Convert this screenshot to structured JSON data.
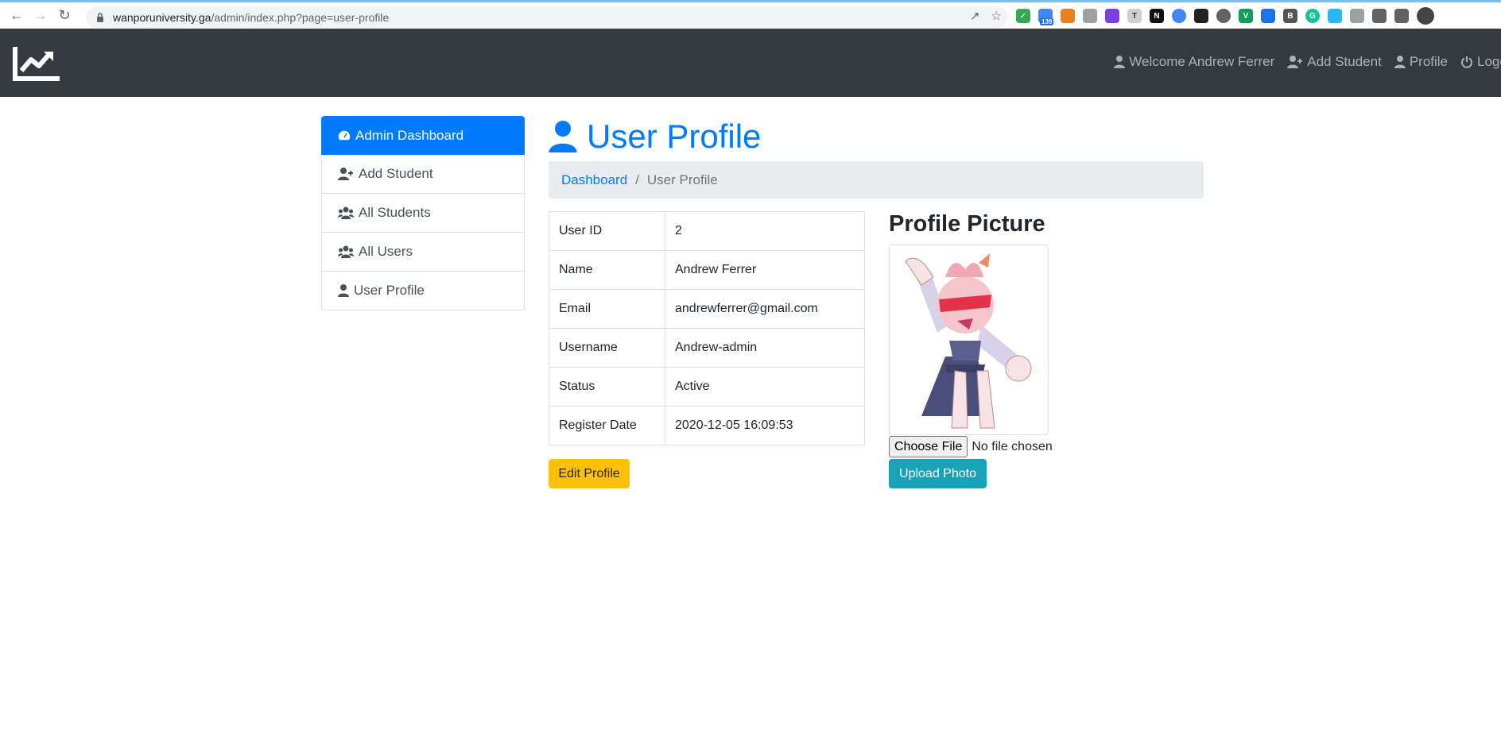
{
  "browser": {
    "url_host": "wanporuniversity.ga",
    "url_path": "/admin/index.php?page=user-profile",
    "ext_badge": "139"
  },
  "navbar": {
    "links": [
      {
        "label": "Welcome Andrew Ferrer",
        "icon": "user-icon"
      },
      {
        "label": "Add Student",
        "icon": "user-plus-icon"
      },
      {
        "label": "Profile",
        "icon": "user-icon"
      },
      {
        "label": "Logout",
        "icon": "power-icon"
      }
    ]
  },
  "sidebar": {
    "items": [
      {
        "label": "Admin Dashboard",
        "icon": "tachometer-icon",
        "active": true
      },
      {
        "label": "Add Student",
        "icon": "user-plus-icon"
      },
      {
        "label": "All Students",
        "icon": "users-icon"
      },
      {
        "label": "All Users",
        "icon": "users-icon"
      },
      {
        "label": "User Profile",
        "icon": "user-icon"
      }
    ]
  },
  "main": {
    "title": "User Profile",
    "breadcrumb": {
      "link": "Dashboard",
      "separator": "/",
      "active": "User Profile"
    },
    "profile_rows": [
      {
        "label": "User ID",
        "value": "2"
      },
      {
        "label": "Name",
        "value": "Andrew Ferrer"
      },
      {
        "label": "Email",
        "value": "andrewferrer@gmail.com"
      },
      {
        "label": "Username",
        "value": "Andrew-admin"
      },
      {
        "label": "Status",
        "value": "Active"
      },
      {
        "label": "Register Date",
        "value": "2020-12-05 16:09:53"
      }
    ],
    "edit_button": "Edit Profile",
    "picture_heading": "Profile Picture",
    "file_button": "Choose File",
    "file_status": "No file chosen",
    "upload_button": "Upload Photo"
  },
  "colors": {
    "primary": "#007bff",
    "navbar": "#343a40",
    "warning": "#ffc107",
    "info": "#17a2b8"
  }
}
